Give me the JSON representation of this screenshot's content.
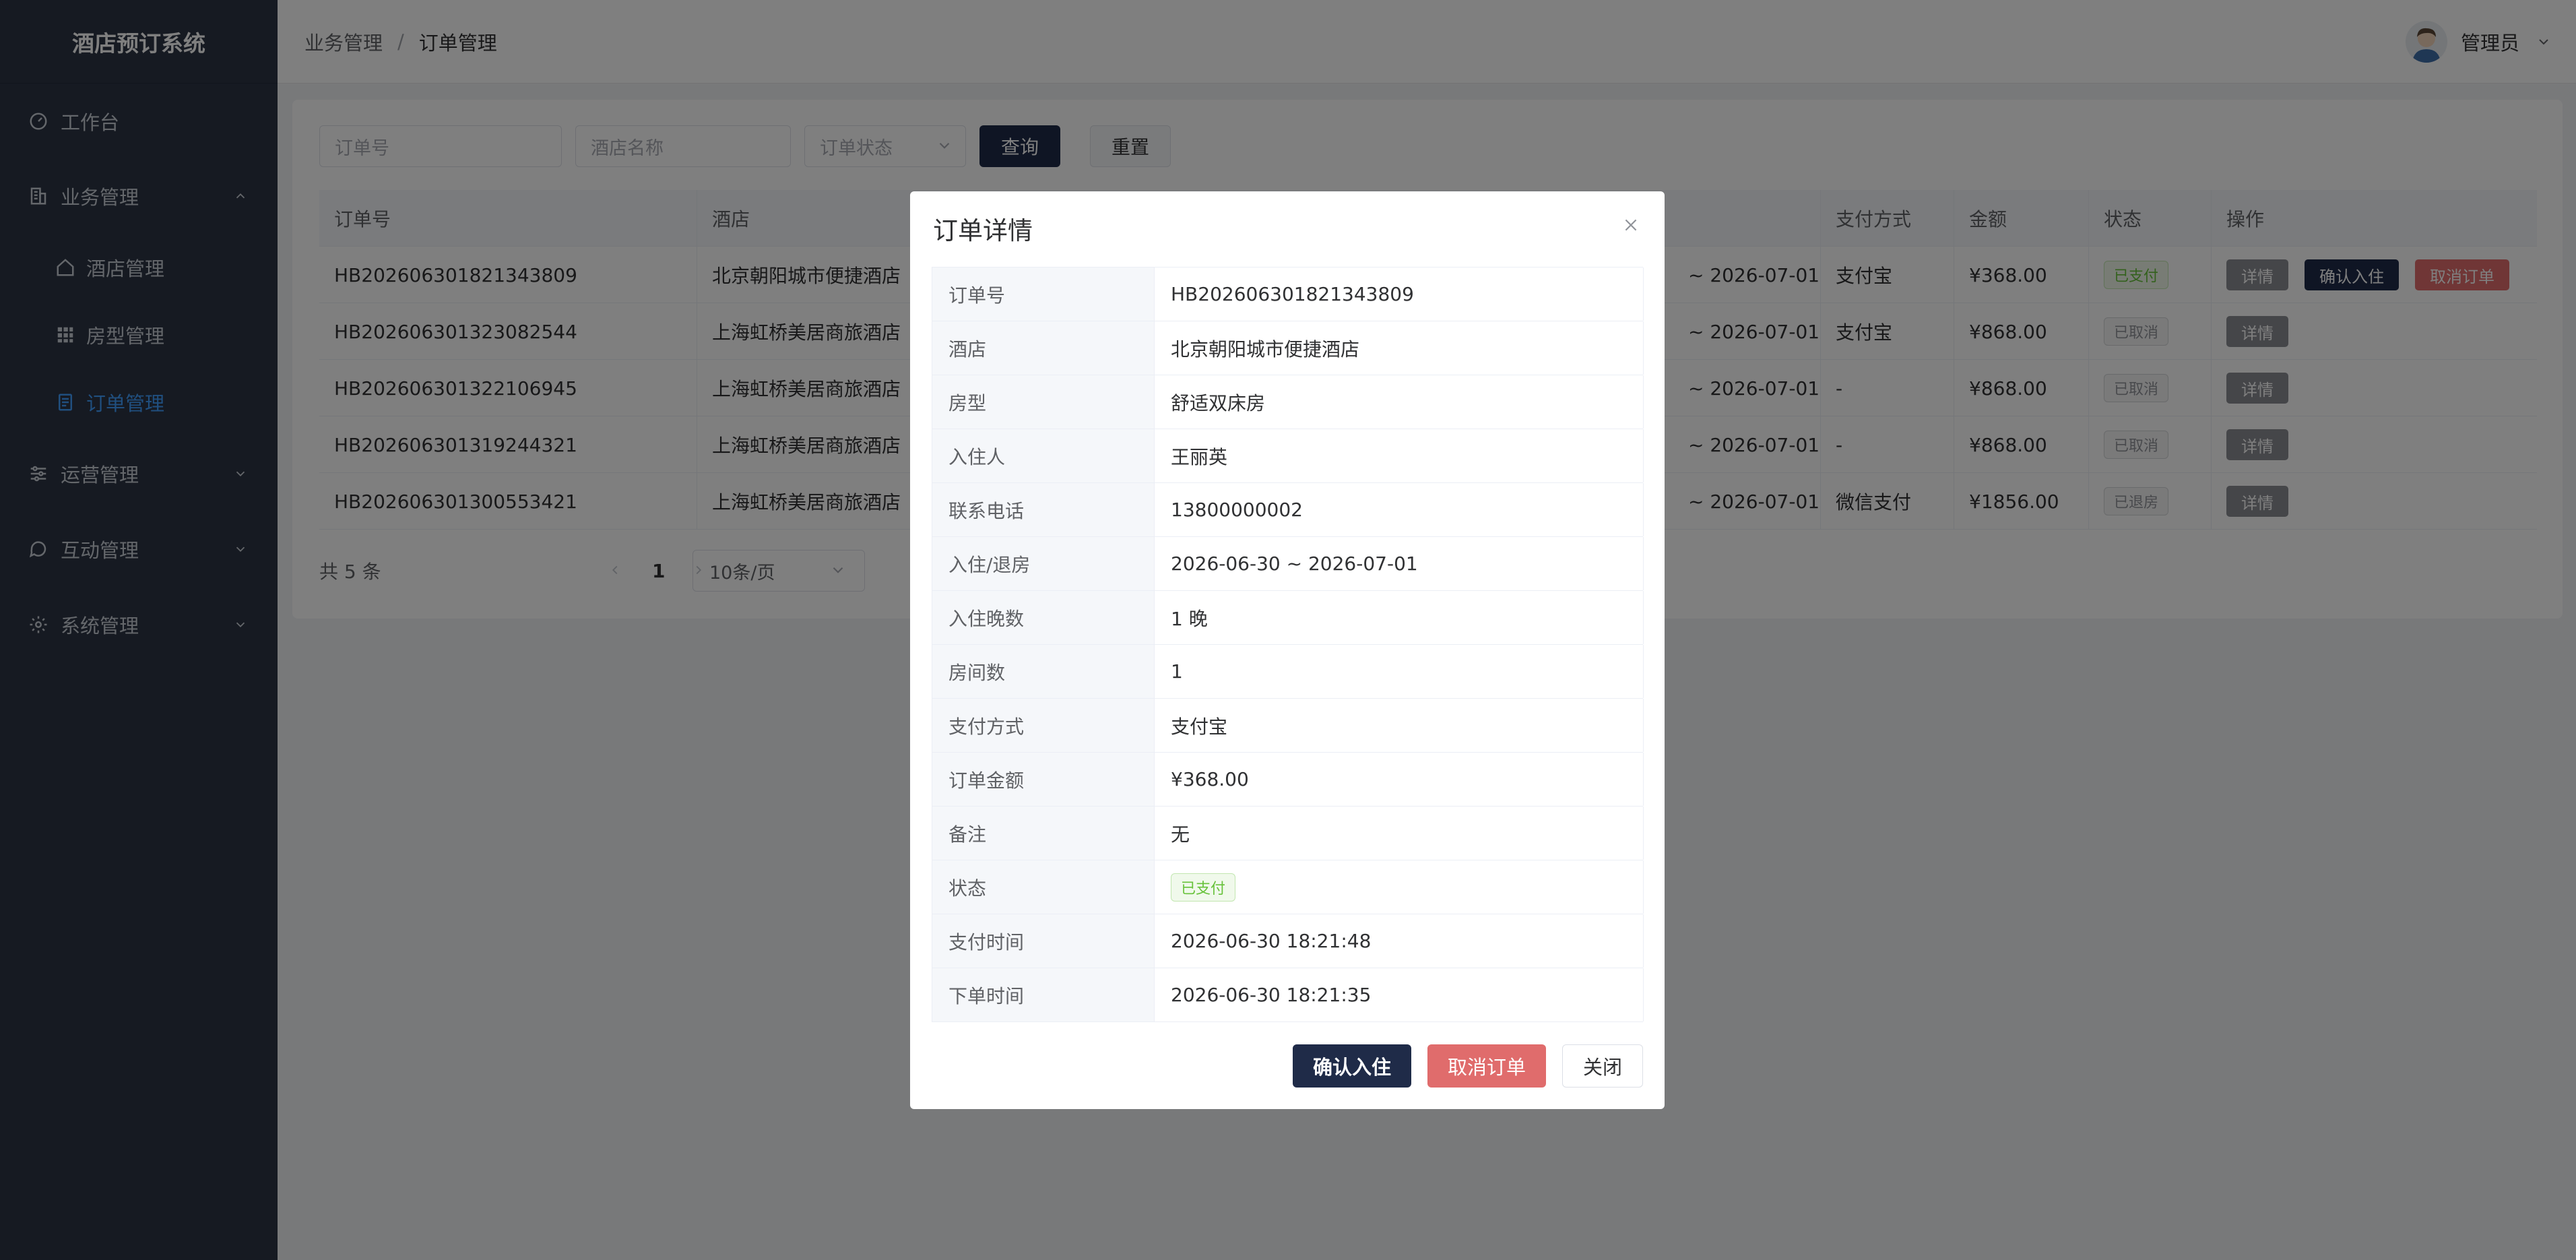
{
  "app": {
    "title": "酒店预订系统"
  },
  "sidebar": {
    "items": [
      {
        "label": "工作台",
        "icon": "dashboard-icon"
      },
      {
        "label": "业务管理",
        "icon": "building-icon"
      },
      {
        "label": "酒店管理",
        "icon": "home-icon"
      },
      {
        "label": "房型管理",
        "icon": "grid-icon"
      },
      {
        "label": "订单管理",
        "icon": "document-icon"
      },
      {
        "label": "运营管理",
        "icon": "sliders-icon"
      },
      {
        "label": "互动管理",
        "icon": "chat-icon"
      },
      {
        "label": "系统管理",
        "icon": "gear-icon"
      }
    ]
  },
  "header": {
    "breadcrumb": [
      "业务管理",
      "订单管理"
    ],
    "separator": "/",
    "user": "管理员"
  },
  "filters": {
    "order_no_placeholder": "订单号",
    "hotel_placeholder": "酒店名称",
    "status_placeholder": "订单状态",
    "search_label": "查询",
    "reset_label": "重置"
  },
  "table": {
    "columns": [
      "订单号",
      "酒店",
      "支付方式",
      "金额",
      "状态",
      "操作"
    ],
    "rows": [
      {
        "order_no": "HB202606301821343809",
        "hotel": "北京朝阳城市便捷酒店",
        "dates": "~ 2026-07-01",
        "payment": "支付宝",
        "amount": "¥368.00",
        "status": "已支付"
      },
      {
        "order_no": "HB202606301323082544",
        "hotel": "上海虹桥美居商旅酒店",
        "dates": "~ 2026-07-01",
        "payment": "支付宝",
        "amount": "¥868.00",
        "status": "已取消"
      },
      {
        "order_no": "HB202606301322106945",
        "hotel": "上海虹桥美居商旅酒店",
        "dates": "~ 2026-07-01",
        "payment": "-",
        "amount": "¥868.00",
        "status": "已取消"
      },
      {
        "order_no": "HB202606301319244321",
        "hotel": "上海虹桥美居商旅酒店",
        "dates": "~ 2026-07-01",
        "payment": "-",
        "amount": "¥868.00",
        "status": "已取消"
      },
      {
        "order_no": "HB202606301300553421",
        "hotel": "上海虹桥美居商旅酒店",
        "dates": "~ 2026-07-01",
        "payment": "微信支付",
        "amount": "¥1856.00",
        "status": "已退房"
      }
    ],
    "actions": {
      "detail": "详情",
      "confirm": "确认入住",
      "cancel": "取消订单"
    }
  },
  "pagination": {
    "total": "共 5 条",
    "page_size": "10条/页",
    "current": "1"
  },
  "modal": {
    "title": "订单详情",
    "fields": [
      {
        "label": "订单号",
        "value": "HB202606301821343809"
      },
      {
        "label": "酒店",
        "value": "北京朝阳城市便捷酒店"
      },
      {
        "label": "房型",
        "value": "舒适双床房"
      },
      {
        "label": "入住人",
        "value": "王丽英"
      },
      {
        "label": "联系电话",
        "value": "13800000002"
      },
      {
        "label": "入住/退房",
        "value": "2026-06-30 ~ 2026-07-01"
      },
      {
        "label": "入住晚数",
        "value": "1 晚"
      },
      {
        "label": "房间数",
        "value": "1"
      },
      {
        "label": "支付方式",
        "value": "支付宝"
      },
      {
        "label": "订单金额",
        "value": "¥368.00"
      },
      {
        "label": "备注",
        "value": "无"
      },
      {
        "label": "状态",
        "value": "已支付"
      },
      {
        "label": "支付时间",
        "value": "2026-06-30 18:21:48"
      },
      {
        "label": "下单时间",
        "value": "2026-06-30 18:21:35"
      }
    ],
    "confirm_label": "确认入住",
    "cancel_label": "取消订单",
    "close_label": "关闭"
  },
  "colors": {
    "sidebar_bg": "#2c3444",
    "primary_navy": "#1f2b48",
    "danger_red": "#e06c6c",
    "active_blue": "#409eff",
    "paid_green": "#67c23a"
  }
}
